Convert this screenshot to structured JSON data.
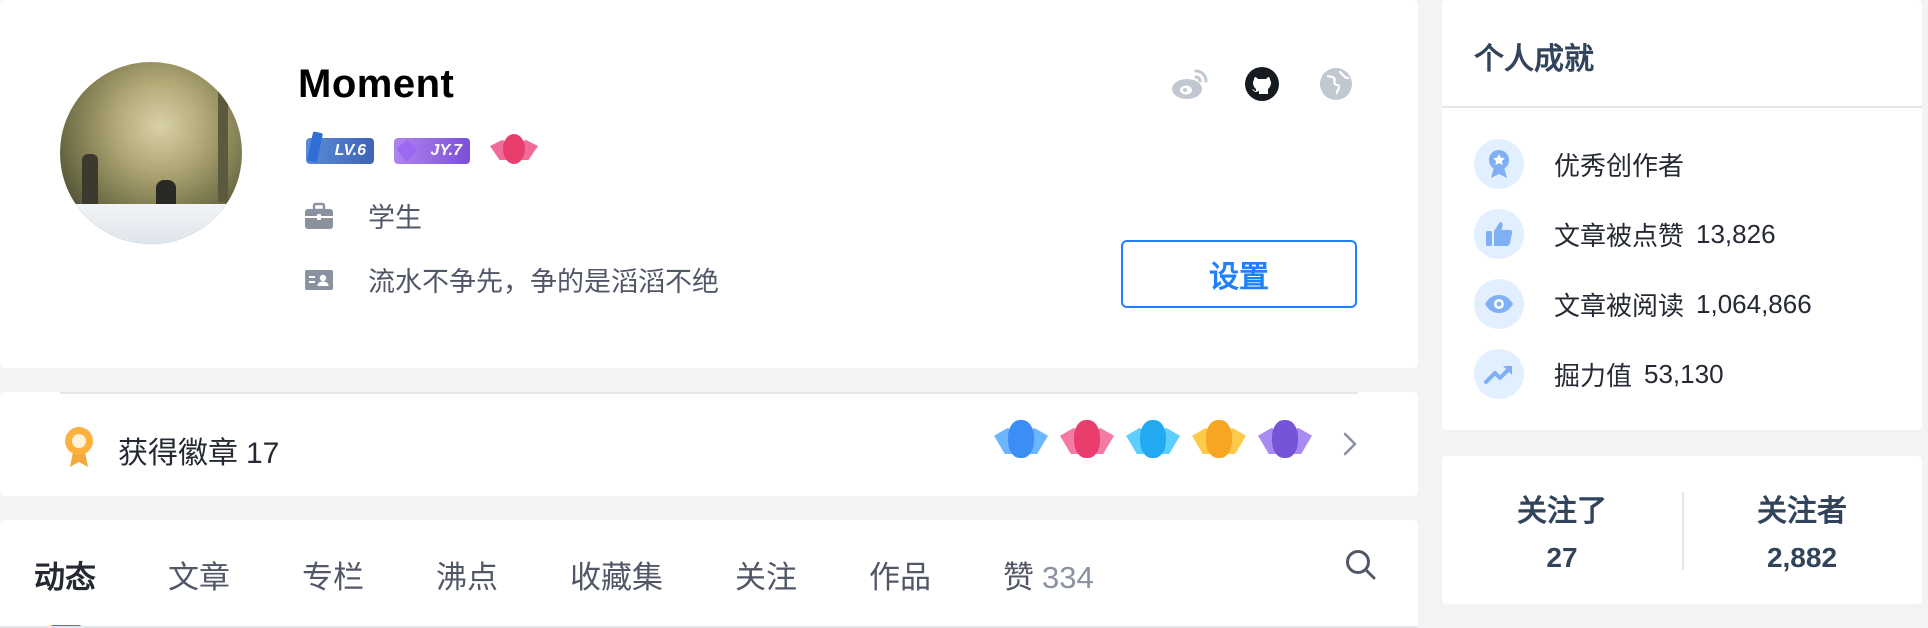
{
  "profile": {
    "username": "Moment",
    "level_badge": "LV.6",
    "jy_badge": "JY.7",
    "job": "学生",
    "bio": "流水不争先，争的是滔滔不绝",
    "settings_label": "设置"
  },
  "badges": {
    "title": "获得徽章",
    "count": "17"
  },
  "tabs": {
    "items": [
      {
        "label": "动态",
        "active": true
      },
      {
        "label": "文章"
      },
      {
        "label": "专栏"
      },
      {
        "label": "沸点"
      },
      {
        "label": "收藏集"
      },
      {
        "label": "关注"
      },
      {
        "label": "作品"
      }
    ],
    "likes_label": "赞",
    "likes_count": "334"
  },
  "achievements": {
    "title": "个人成就",
    "items": [
      {
        "label": "优秀创作者",
        "value": ""
      },
      {
        "label": "文章被点赞",
        "value": "13,826"
      },
      {
        "label": "文章被阅读",
        "value": "1,064,866"
      },
      {
        "label": "掘力值",
        "value": "53,130"
      }
    ]
  },
  "follow": {
    "following_label": "关注了",
    "following_count": "27",
    "followers_label": "关注者",
    "followers_count": "2,882"
  },
  "colors": {
    "accent": "#1e80ff",
    "icon_blue": "#6fa6f0",
    "icon_bg": "#e1efff",
    "text_primary": "#252933",
    "text_secondary": "#515767",
    "muted": "#8a919f"
  }
}
